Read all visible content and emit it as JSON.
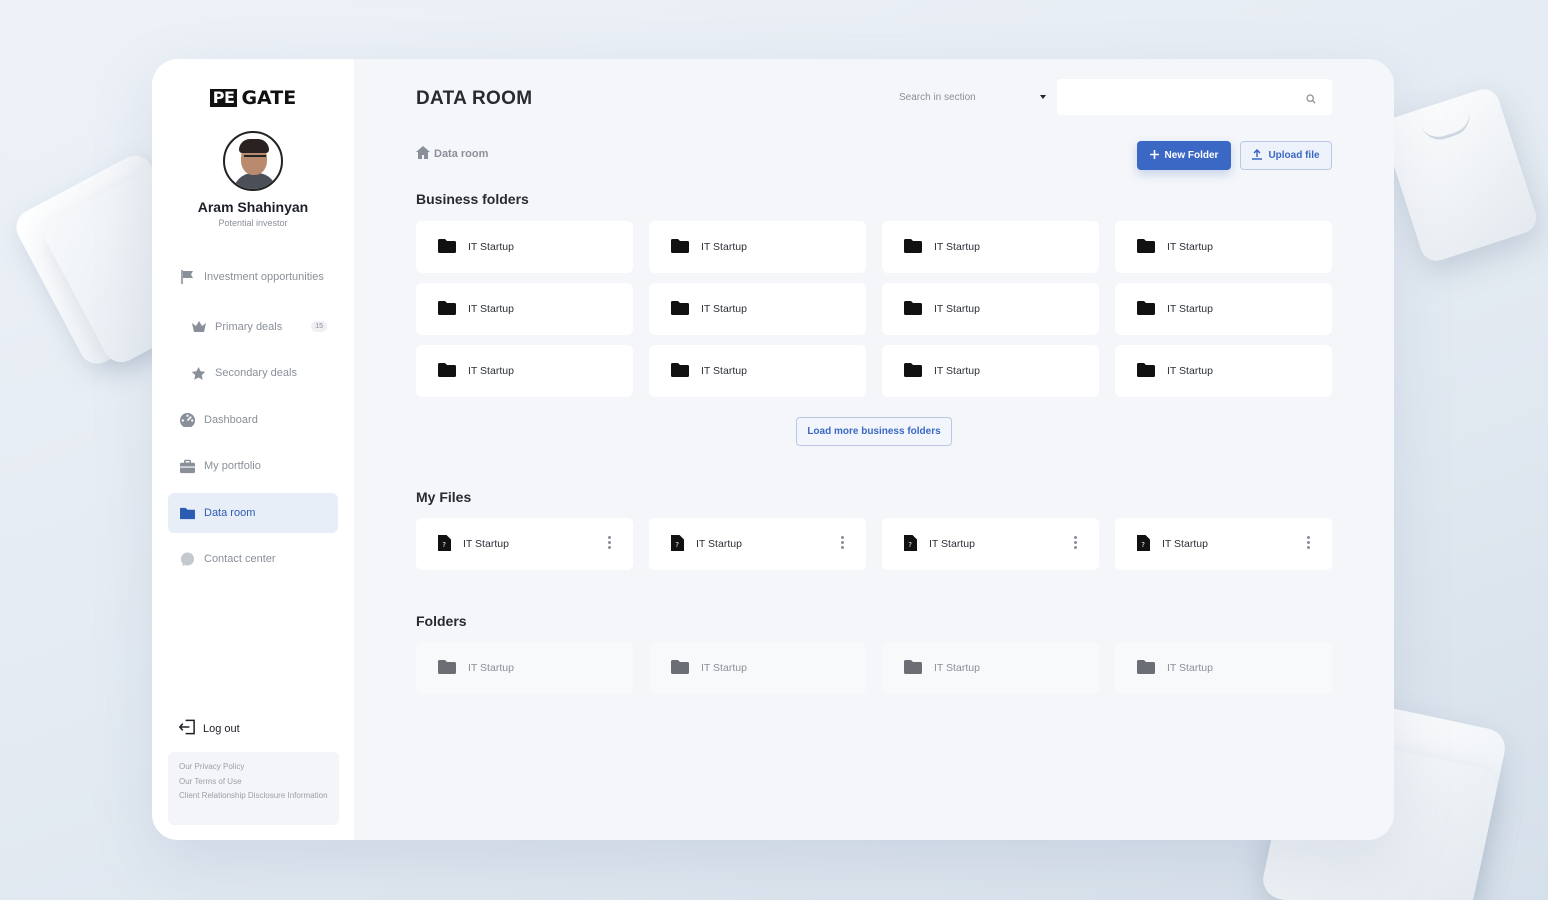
{
  "brand": {
    "logo_mark": "PE",
    "logo_text": "GATE"
  },
  "user": {
    "name": "Aram Shahinyan",
    "role": "Potential investor"
  },
  "nav": {
    "investment": "Investment opportunities",
    "primary": "Primary deals",
    "primary_badge": "15",
    "secondary": "Secondary deals",
    "dashboard": "Dashboard",
    "portfolio": "My portfolio",
    "dataroom": "Data room",
    "contact": "Contact center"
  },
  "logout": "Log out",
  "footer": {
    "privacy": "Our Privacy Policy",
    "terms": "Our Terms of Use",
    "disclosure": "Client Relationship Disclosure Information"
  },
  "header": {
    "title": "DATA ROOM",
    "search_scope": "Search in section",
    "search_placeholder": ""
  },
  "breadcrumb": "Data room",
  "actions": {
    "new_folder": "New Folder",
    "upload": "Upload file"
  },
  "business_folders": {
    "title": "Business folders",
    "items": [
      "IT Startup",
      "IT Startup",
      "IT Startup",
      "IT Startup",
      "IT Startup",
      "IT Startup",
      "IT Startup",
      "IT Startup",
      "IT Startup",
      "IT Startup",
      "IT Startup",
      "IT Startup"
    ],
    "load_more": "Load more business folders"
  },
  "my_files": {
    "title": "My Files",
    "items": [
      "IT Startup",
      "IT Startup",
      "IT Startup",
      "IT Startup"
    ]
  },
  "folders": {
    "title": "Folders",
    "items": [
      "IT Startup",
      "IT Startup",
      "IT Startup",
      "IT Startup"
    ]
  },
  "colors": {
    "accent": "#3a68c4",
    "active_bg": "#e8eef8"
  }
}
